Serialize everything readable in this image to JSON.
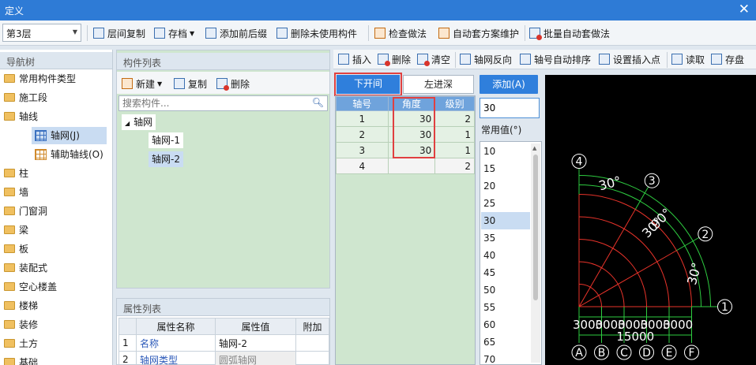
{
  "window": {
    "title": "定义",
    "close_icon": "✕"
  },
  "toolbar": {
    "floor": "第3层",
    "buttons": [
      {
        "label": "层间复制"
      },
      {
        "label": "存档"
      },
      {
        "label": "添加前后缀"
      },
      {
        "label": "删除未使用构件"
      },
      {
        "label": "检查做法"
      },
      {
        "label": "自动套方案维护"
      },
      {
        "label": "批量自动套做法"
      }
    ]
  },
  "nav": {
    "title": "导航树",
    "items": [
      {
        "label": "常用构件类型"
      },
      {
        "label": "施工段"
      },
      {
        "label": "轴线"
      },
      {
        "label": "柱"
      },
      {
        "label": "墙"
      },
      {
        "label": "门窗洞"
      },
      {
        "label": "梁"
      },
      {
        "label": "板"
      },
      {
        "label": "装配式"
      },
      {
        "label": "空心楼盖"
      },
      {
        "label": "楼梯"
      },
      {
        "label": "装修"
      },
      {
        "label": "土方"
      },
      {
        "label": "基础"
      }
    ],
    "subitems": [
      {
        "label": "轴网(J)"
      },
      {
        "label": "辅助轴线(O)"
      }
    ]
  },
  "component_list": {
    "title": "构件列表",
    "new_label": "新建",
    "copy_label": "复制",
    "delete_label": "删除",
    "search_placeholder": "搜索构件...",
    "tree": {
      "root": "轴网",
      "children": [
        "轴网-1",
        "轴网-2"
      ]
    }
  },
  "property_list": {
    "title": "属性列表",
    "headers": [
      "属性名称",
      "属性值",
      "附加"
    ],
    "rows": [
      {
        "no": "1",
        "name": "名称",
        "value": "轴网-2"
      },
      {
        "no": "2",
        "name": "轴网类型",
        "value": "圆弧轴网"
      }
    ]
  },
  "right_toolbar": {
    "buttons": [
      {
        "label": "插入"
      },
      {
        "label": "删除"
      },
      {
        "label": "清空"
      },
      {
        "label": "轴网反向"
      },
      {
        "label": "轴号自动排序"
      },
      {
        "label": "设置插入点"
      },
      {
        "label": "读取"
      },
      {
        "label": "存盘"
      }
    ]
  },
  "axis_editor": {
    "tab_lower": "下开间",
    "tab_left": "左进深",
    "headers": [
      "轴号",
      "角度",
      "级别"
    ],
    "rows": [
      {
        "axis": "1",
        "angle": "30",
        "level": "2"
      },
      {
        "axis": "2",
        "angle": "30",
        "level": "1"
      },
      {
        "axis": "3",
        "angle": "30",
        "level": "1"
      },
      {
        "axis": "4",
        "angle": "",
        "level": "2"
      }
    ],
    "add_label": "添加(A)",
    "input_value": "30",
    "common_label": "常用值(°)",
    "common_values": [
      "10",
      "15",
      "20",
      "25",
      "30",
      "35",
      "40",
      "45",
      "50",
      "55",
      "60",
      "65",
      "70"
    ],
    "selected_common": "30"
  },
  "preview": {
    "radial_labels": [
      "1",
      "2",
      "3",
      "4"
    ],
    "angle_labels": [
      "30°",
      "90°",
      "30°",
      "30°"
    ],
    "bottom_letters": [
      "A",
      "B",
      "C",
      "D",
      "E",
      "F"
    ],
    "dim_labels": [
      "3000",
      "3000",
      "3000",
      "3000",
      "3000"
    ],
    "total_dim": "15000",
    "colors": {
      "arc": "#e8332a",
      "dim": "#2ecc40",
      "text": "#ffffff"
    }
  }
}
